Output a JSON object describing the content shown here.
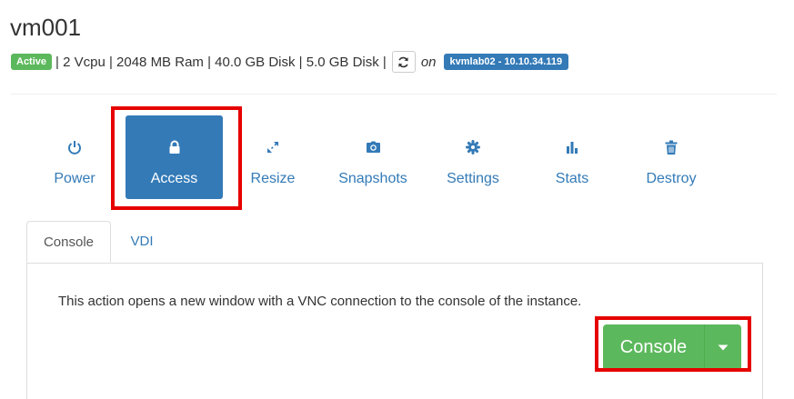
{
  "vm": {
    "name": "vm001",
    "status": "Active",
    "specs": "| 2 Vcpu | 2048 MB Ram | 40.0 GB Disk | 5.0 GB Disk |",
    "on_label": "on",
    "host": "kvmlab02 - 10.10.34.119"
  },
  "actions": [
    {
      "label": "Power",
      "icon": "power-icon"
    },
    {
      "label": "Access",
      "icon": "lock-icon",
      "active": true
    },
    {
      "label": "Resize",
      "icon": "expand-icon"
    },
    {
      "label": "Snapshots",
      "icon": "camera-icon"
    },
    {
      "label": "Settings",
      "icon": "gear-icon"
    },
    {
      "label": "Stats",
      "icon": "bar-chart-icon"
    },
    {
      "label": "Destroy",
      "icon": "trash-icon"
    }
  ],
  "tabs": [
    {
      "label": "Console",
      "active": true
    },
    {
      "label": "VDI",
      "active": false
    }
  ],
  "console_panel": {
    "description": "This action opens a new window with a VNC connection to the console of the instance.",
    "button_label": "Console"
  },
  "colors": {
    "primary": "#337ab7",
    "success": "#5cb85c",
    "highlight": "#e60000"
  }
}
